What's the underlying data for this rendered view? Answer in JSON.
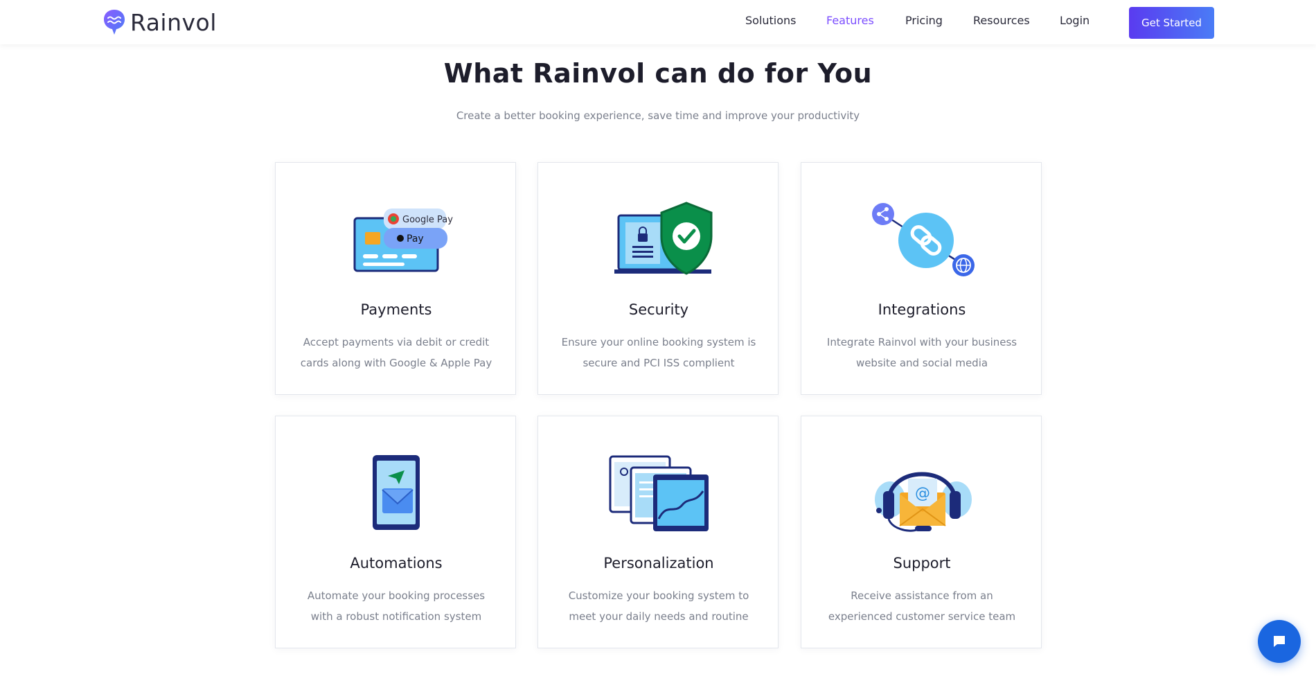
{
  "brand": {
    "name": "Rainvol"
  },
  "nav": {
    "items": [
      "Solutions",
      "Features",
      "Pricing",
      "Resources",
      "Login"
    ],
    "active": "Features",
    "cta_label": "Get Started"
  },
  "hero": {
    "title": "What Rainvol can do for You",
    "subtitle": "Create a better booking experience, save time and improve your productivity"
  },
  "features": [
    {
      "title": "Payments",
      "desc": "Accept payments via debit or credit cards along with Google & Apple Pay",
      "icon": "payment-card-icon",
      "badges": [
        "Google Pay",
        "Pay"
      ]
    },
    {
      "title": "Security",
      "desc": "Ensure your online booking system is secure and PCI ISS complient",
      "icon": "security-shield-icon"
    },
    {
      "title": "Integrations",
      "desc": "Integrate Rainvol with your business website and social media",
      "icon": "integration-link-icon"
    },
    {
      "title": "Automations",
      "desc": "Automate your booking processes with a robust notification system",
      "icon": "phone-mail-icon"
    },
    {
      "title": "Personalization",
      "desc": "Customize your booking system to meet your daily needs and routine",
      "icon": "dashboard-screens-icon"
    },
    {
      "title": "Support",
      "desc": "Receive assistance from an experienced customer service team",
      "icon": "headset-mail-icon"
    }
  ],
  "colors": {
    "accent": "#7b4dff",
    "cta_start": "#5a3bf0",
    "cta_end": "#4a7cf6",
    "chat": "#1a66e0",
    "muted": "#7a7f8c"
  }
}
